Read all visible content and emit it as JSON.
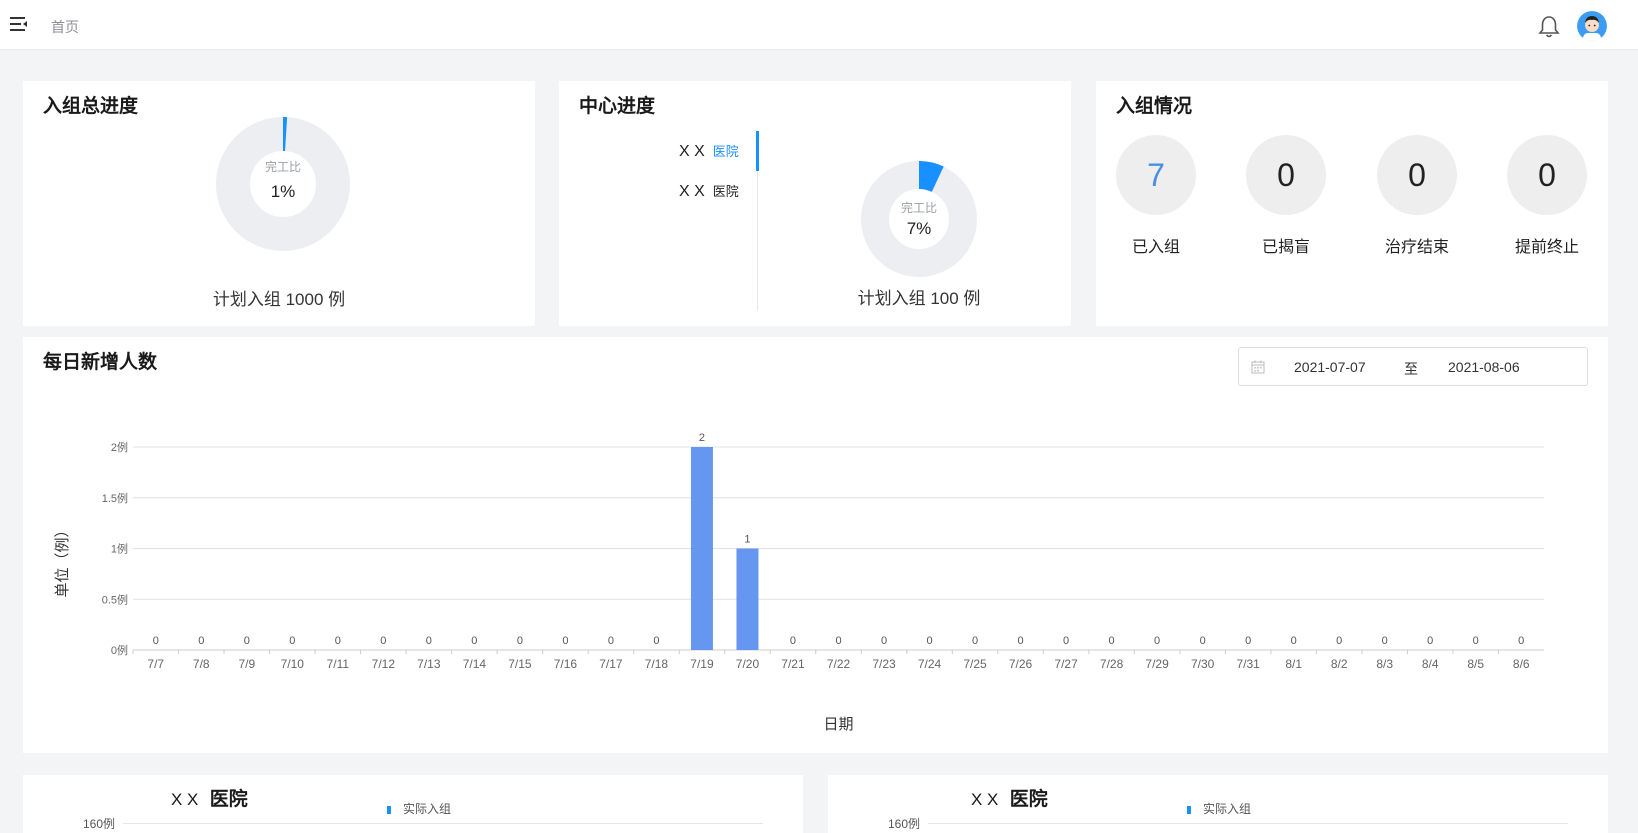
{
  "header": {
    "breadcrumb": "首页",
    "menu_icon": "menu-fold-icon",
    "bell_icon": "bell-icon",
    "avatar_icon": "avatar-icon"
  },
  "overall_progress": {
    "title": "入组总进度",
    "donut_label": "完工比",
    "percent_text": "1%",
    "percent": 1,
    "plan_text": "计划入组 1000 例"
  },
  "center_progress": {
    "title": "中心进度",
    "hospitals": [
      {
        "name": "X X",
        "suffix": "医院",
        "active": true
      },
      {
        "name": "X X",
        "suffix": "医院",
        "active": false
      }
    ],
    "donut_label": "完工比",
    "percent_text": "7%",
    "percent": 7,
    "plan_text": "计划入组 100 例"
  },
  "enrollment_status": {
    "title": "入组情况",
    "stats": [
      {
        "value": "7",
        "label": "已入组",
        "highlight": true
      },
      {
        "value": "0",
        "label": "已揭盲",
        "highlight": false
      },
      {
        "value": "0",
        "label": "治疗结束",
        "highlight": false
      },
      {
        "value": "0",
        "label": "提前终止",
        "highlight": false
      }
    ]
  },
  "daily": {
    "title": "每日新增人数",
    "date_start": "2021-07-07",
    "date_sep": "至",
    "date_end": "2021-08-06",
    "calendar_icon": "calendar-icon"
  },
  "colors": {
    "accent": "#1890ff",
    "bar": "#6597f0",
    "track": "#eceef2",
    "highlight_text": "#4a90e2"
  },
  "chart_data": {
    "type": "bar",
    "ylabel": "单位（例）",
    "xlabel": "日期",
    "ylim": [
      0,
      2
    ],
    "yticks": [
      "0例",
      "0.5例",
      "1例",
      "1.5例",
      "2例"
    ],
    "categories": [
      "7/7",
      "7/8",
      "7/9",
      "7/10",
      "7/11",
      "7/12",
      "7/13",
      "7/14",
      "7/15",
      "7/16",
      "7/17",
      "7/18",
      "7/19",
      "7/20",
      "7/21",
      "7/22",
      "7/23",
      "7/24",
      "7/25",
      "7/26",
      "7/27",
      "7/28",
      "7/29",
      "7/30",
      "7/31",
      "8/1",
      "8/2",
      "8/3",
      "8/4",
      "8/5",
      "8/6"
    ],
    "values": [
      0,
      0,
      0,
      0,
      0,
      0,
      0,
      0,
      0,
      0,
      0,
      0,
      2,
      1,
      0,
      0,
      0,
      0,
      0,
      0,
      0,
      0,
      0,
      0,
      0,
      0,
      0,
      0,
      0,
      0,
      0
    ],
    "grid": true
  },
  "bottom_charts": [
    {
      "title_name": "X X",
      "title_suffix": "医院",
      "legend": "实际入组",
      "ytick": "160例"
    },
    {
      "title_name": "X X",
      "title_suffix": "医院",
      "legend": "实际入组",
      "ytick": "160例"
    }
  ]
}
